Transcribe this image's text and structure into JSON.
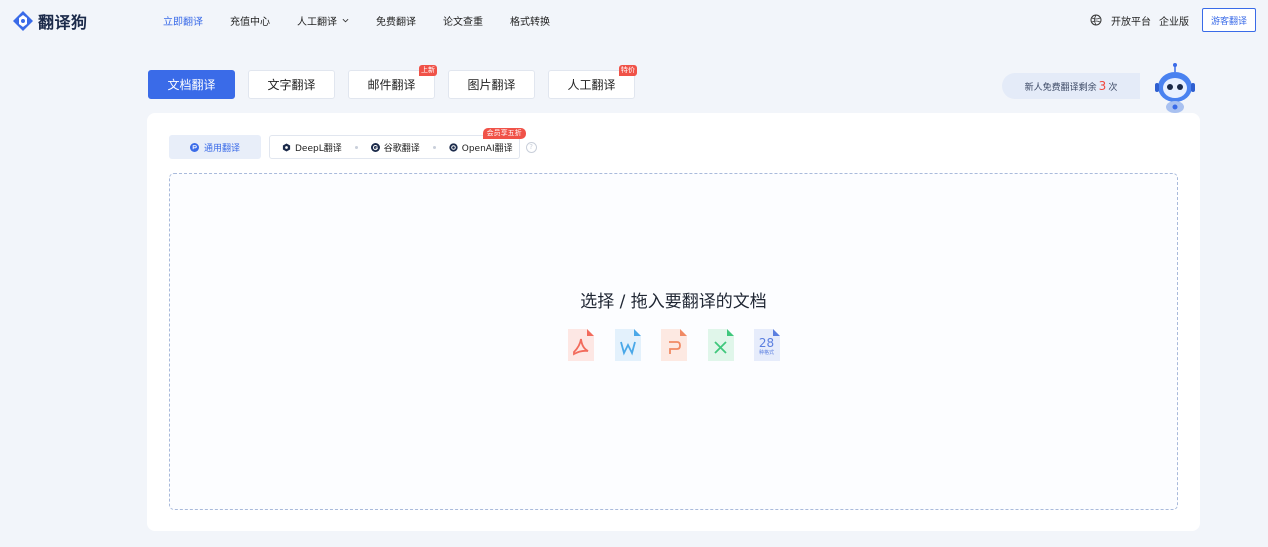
{
  "brand": {
    "name": "翻译狗",
    "logo_icon": "dog-logo-icon",
    "brand_color": "#3a6be8"
  },
  "nav": {
    "items": [
      {
        "label": "立即翻译",
        "active": true
      },
      {
        "label": "充值中心"
      },
      {
        "label": "人工翻译",
        "has_dropdown": true
      },
      {
        "label": "免费翻译"
      },
      {
        "label": "论文查重"
      },
      {
        "label": "格式转换"
      }
    ],
    "right": {
      "platform_icon": "globe-icon",
      "open_platform": "开放平台",
      "enterprise": "企业版",
      "guest_button": "游客翻译"
    }
  },
  "mode_tabs": [
    {
      "label": "文档翻译",
      "active": true
    },
    {
      "label": "文字翻译"
    },
    {
      "label": "邮件翻译",
      "badge": "上新"
    },
    {
      "label": "图片翻译"
    },
    {
      "label": "人工翻译",
      "badge": "特价"
    }
  ],
  "free_quota": {
    "prefix": "新人免费翻译剩余",
    "count": "3",
    "suffix": "次"
  },
  "engines": {
    "general": "通用翻译",
    "options": [
      {
        "label": "DeepL翻译",
        "icon": "deepl-icon"
      },
      {
        "label": "谷歌翻译",
        "icon": "google-icon"
      },
      {
        "label": "OpenAI翻译",
        "icon": "openai-icon"
      }
    ],
    "member_badge": "会员享五折",
    "help_symbol": "?"
  },
  "dropzone": {
    "title": "选择 / 拖入要翻译的文档",
    "formats": [
      {
        "type": "pdf",
        "color": "#f26b5c"
      },
      {
        "type": "word",
        "color": "#4aa8e8"
      },
      {
        "type": "ppt",
        "color": "#f08a64"
      },
      {
        "type": "excel",
        "color": "#3fc77c"
      },
      {
        "type": "more",
        "color": "#5b7fe0",
        "count": "28",
        "label": "种格式"
      }
    ]
  },
  "colors": {
    "accent": "#3a6be8",
    "badge_red": "#f05248",
    "bg": "#f2f5fa"
  }
}
